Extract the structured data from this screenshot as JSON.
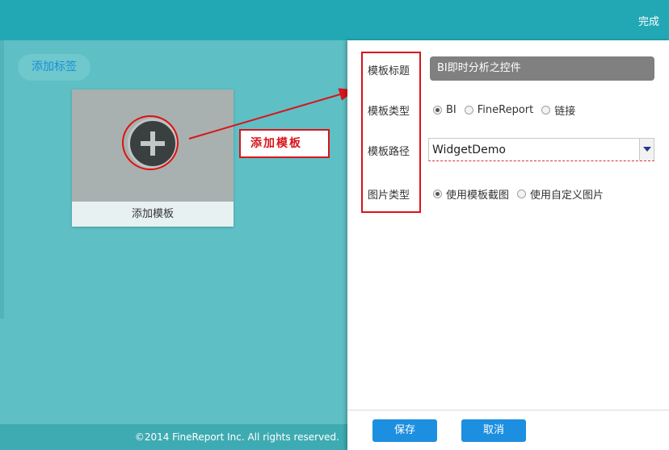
{
  "topbar": {
    "done_label": "完成"
  },
  "left": {
    "add_tag_label": "添加标签",
    "tile_label": "添加模板",
    "callout_label": "添加模板"
  },
  "footer": {
    "copyright": "©2014 FineReport Inc. All rights reserved."
  },
  "form": {
    "title_label": "模板标题",
    "title_value": "BI即时分析之控件",
    "type_label": "模板类型",
    "type_options": [
      "BI",
      "FineReport",
      "链接"
    ],
    "type_selected": "BI",
    "path_label": "模板路径",
    "path_value": "WidgetDemo",
    "image_label": "图片类型",
    "image_options": [
      "使用模板截图",
      "使用自定义图片"
    ],
    "image_selected": "使用模板截图"
  },
  "actions": {
    "save_label": "保存",
    "cancel_label": "取消"
  },
  "colors": {
    "accent": "#22a8b4",
    "button": "#1d8fe0",
    "annotation": "#d8141a"
  }
}
